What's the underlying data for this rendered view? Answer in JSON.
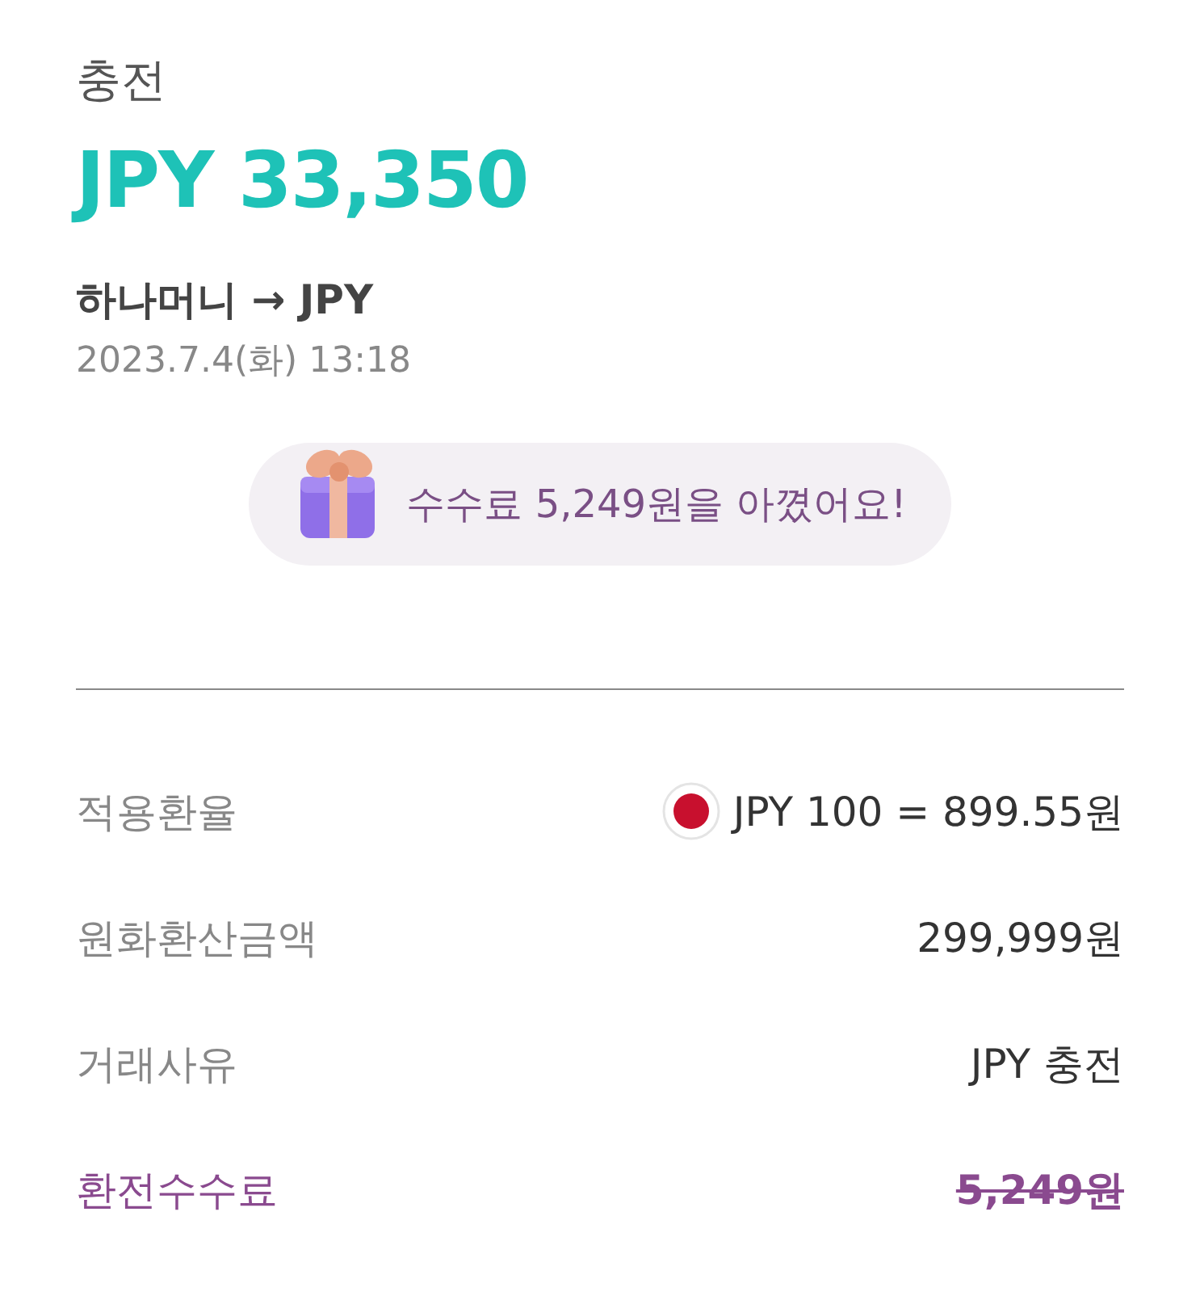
{
  "header": {
    "title": "충전",
    "amount": "JPY 33,350"
  },
  "transaction": {
    "route": "하나머니 → JPY",
    "datetime": "2023.7.4(화) 13:18"
  },
  "promo": {
    "message": "수수료 5,249원을 아꼈어요!"
  },
  "details": [
    {
      "kind": "rate",
      "label": "적용환율",
      "value": "JPY 100 = 899.55원"
    },
    {
      "kind": "plain",
      "label": "원화환산금액",
      "value": "299,999원"
    },
    {
      "kind": "plain",
      "label": "거래사유",
      "value": "JPY 충전"
    },
    {
      "kind": "waived",
      "label": "환전수수료",
      "value": "5,249원"
    }
  ]
}
